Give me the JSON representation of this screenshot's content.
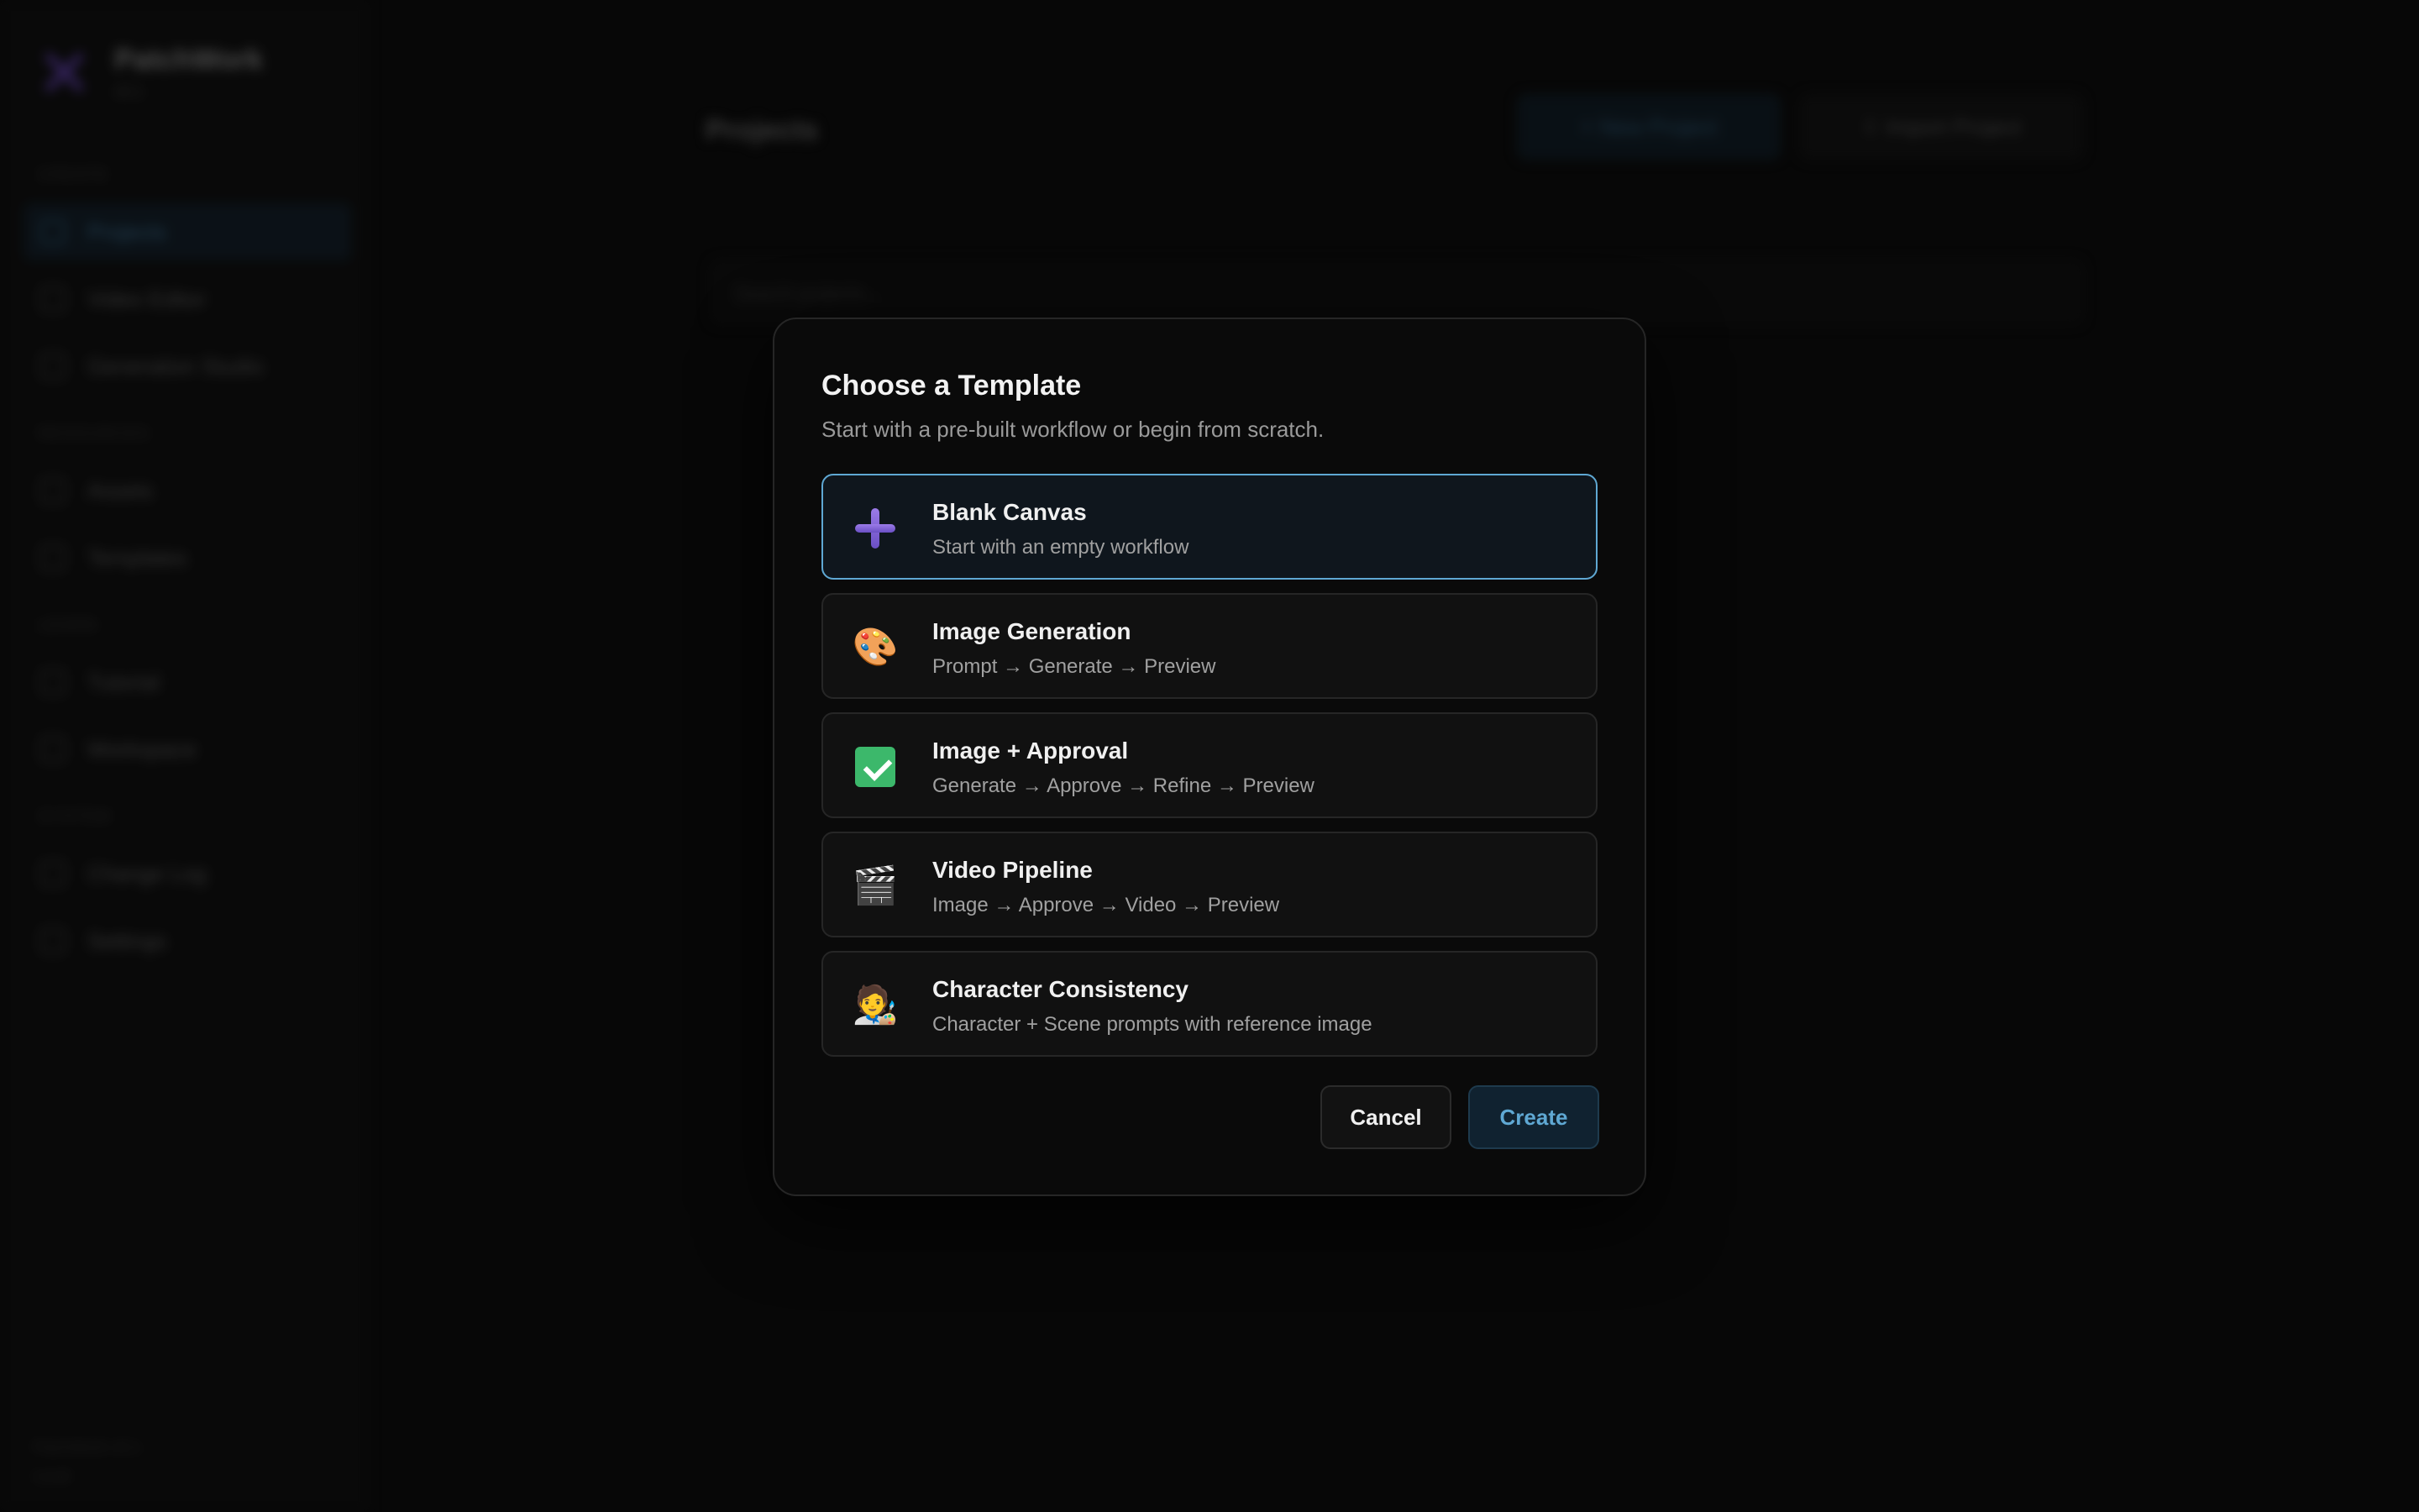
{
  "app": {
    "brand_name": "PatchWork",
    "brand_version": "v0.1",
    "nav_sections": [
      {
        "label": "Create"
      },
      {
        "label": "Resources"
      },
      {
        "label": "Learn"
      },
      {
        "label": "System"
      }
    ],
    "nav_items": [
      {
        "label": "Projects",
        "active": true
      },
      {
        "label": "Video Editor"
      },
      {
        "label": "Generation Studio"
      },
      {
        "label": "Assets"
      },
      {
        "label": "Templates"
      },
      {
        "label": "Tutorial"
      },
      {
        "label": "Workspace"
      },
      {
        "label": "Change Log"
      },
      {
        "label": "Settings"
      }
    ],
    "footer_line1": "PatchWork v0.1",
    "footer_line2": "Local",
    "main_title": "Projects",
    "new_project_label": "+  New Project",
    "import_project_label": "⇩  Import Project",
    "search_placeholder": "Search projects..."
  },
  "modal": {
    "title": "Choose a Template",
    "subtitle": "Start with a pre-built workflow or begin from scratch.",
    "templates": [
      {
        "name": "Blank Canvas",
        "description": "Start with an empty workflow",
        "icon": "plus-icon",
        "selected": true
      },
      {
        "name": "Image Generation",
        "description": "Prompt → Generate → Preview",
        "icon": "palette-icon",
        "glyph": "🎨"
      },
      {
        "name": "Image + Approval",
        "description": "Generate → Approve → Refine → Preview",
        "icon": "check-box-icon"
      },
      {
        "name": "Video Pipeline",
        "description": "Image → Approve → Video → Preview",
        "icon": "clapperboard-icon",
        "glyph": "🎬"
      },
      {
        "name": "Character Consistency",
        "description": "Character + Scene prompts with reference image",
        "icon": "artist-icon",
        "glyph": "🧑‍🎨"
      }
    ],
    "cancel_label": "Cancel",
    "create_label": "Create",
    "accent_color": "#5fa8d3"
  }
}
